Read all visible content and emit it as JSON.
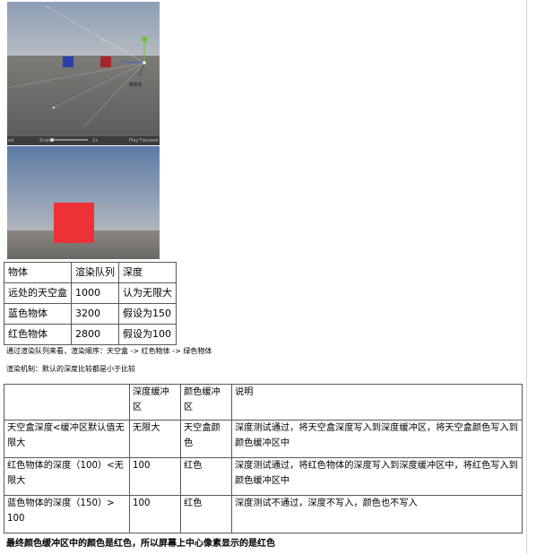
{
  "screenshots": {
    "scene_view": {
      "camera_label": "摄像机",
      "toolbar_left": "ed",
      "toolbar_scale": "Scale",
      "toolbar_scale_value": "1x",
      "toolbar_right": "Play Focused"
    },
    "game_view": {}
  },
  "table_objects": {
    "headers": [
      "物体",
      "渲染队列",
      "深度"
    ],
    "rows": [
      [
        "远处的天空盒",
        "1000",
        "认为无限大"
      ],
      [
        "蓝色物体",
        "3200",
        "假设为150"
      ],
      [
        "红色物体",
        "2800",
        "假设为100"
      ]
    ]
  },
  "caption_order": "通过渲染队列来看，渲染顺序：天空盒 -> 红色物体 -> 绿色物体",
  "caption_mechanism": "渲染机制：默认的深度比较都是小于比较",
  "table_buffers": {
    "headers": [
      "",
      "深度缓冲区",
      "颜色缓冲区",
      "说明"
    ],
    "rows": [
      [
        "天空盒深度<缓冲区默认值无限大",
        "无限大",
        "天空盒颜色",
        "深度测试通过，将天空盒深度写入到深度缓冲区，将天空盒颜色写入到颜色缓冲区中"
      ],
      [
        "红色物体的深度（100）<无限大",
        "100",
        "红色",
        "深度测试通过，将红色物体的深度写入到深度缓冲区中，将红色写入到颜色缓冲区中"
      ],
      [
        "蓝色物体的深度（150）> 100",
        "100",
        "红色",
        "深度测试不通过，深度不写入，颜色也不写入"
      ]
    ]
  },
  "conclusion": "最终颜色缓冲区中的颜色是红色，所以屏幕上中心像素显示的是红色",
  "colors": {
    "red_cube": "#ec3236",
    "blue_cube": "#2a3fa8",
    "dark_red_cube": "#a5232a"
  }
}
